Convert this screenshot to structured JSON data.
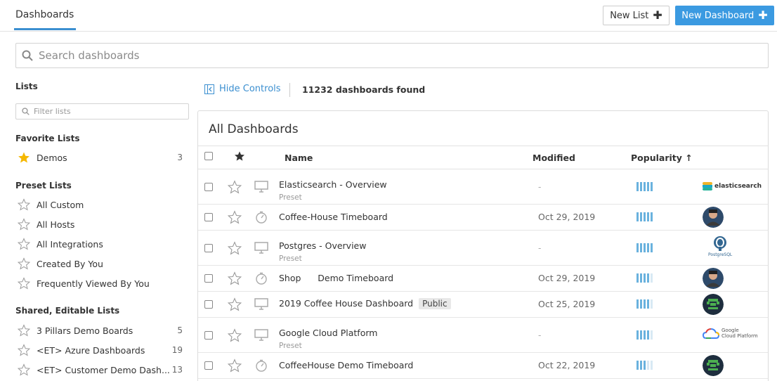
{
  "header": {
    "tab_label": "Dashboards",
    "new_list_label": "New List",
    "new_dashboard_label": "New Dashboard"
  },
  "search": {
    "placeholder": "Search dashboards"
  },
  "sidebar": {
    "lists_heading": "Lists",
    "filter_placeholder": "Filter lists",
    "favorite_heading": "Favorite Lists",
    "favorites": [
      {
        "label": "Demos",
        "count": "3"
      }
    ],
    "preset_heading": "Preset Lists",
    "presets": [
      {
        "label": "All Custom"
      },
      {
        "label": "All Hosts"
      },
      {
        "label": "All Integrations"
      },
      {
        "label": "Created By You"
      },
      {
        "label": "Frequently Viewed By You"
      }
    ],
    "shared_heading": "Shared, Editable Lists",
    "shared": [
      {
        "label": "3 Pillars Demo Boards",
        "count": "5"
      },
      {
        "label": "<ET> Azure Dashboards",
        "count": "19"
      },
      {
        "label": "<ET> Customer Demo Dash...",
        "count": "13"
      }
    ]
  },
  "controls": {
    "hide_controls_label": "Hide Controls",
    "found_text": "11232 dashboards found"
  },
  "table": {
    "title": "All Dashboards",
    "col_name": "Name",
    "col_modified": "Modified",
    "col_popularity": "Popularity",
    "sort_arrow": "↑",
    "rows": [
      {
        "name": "Elasticsearch - Overview",
        "sub": "Preset",
        "modified": "-",
        "popularity": 5,
        "type": "screenboard",
        "owner": "elasticsearch"
      },
      {
        "name": "Coffee-House Timeboard",
        "sub": "",
        "modified": "Oct 29, 2019",
        "popularity": 5,
        "type": "timeboard",
        "owner": "avatar-person"
      },
      {
        "name": "Postgres - Overview",
        "sub": "Preset",
        "modified": "-",
        "popularity": 5,
        "type": "screenboard",
        "owner": "PostgreSQL"
      },
      {
        "name": "Shop      Demo Timeboard",
        "sub": "",
        "modified": "Oct 29, 2019",
        "popularity": 4,
        "type": "timeboard",
        "owner": "avatar-person"
      },
      {
        "name": "2019 Coffee House Dashboard",
        "badge": "Public",
        "sub": "",
        "modified": "Oct 25, 2019",
        "popularity": 4,
        "type": "screenboard",
        "owner": "avatar-robot"
      },
      {
        "name": "Google Cloud Platform",
        "sub": "Preset",
        "modified": "-",
        "popularity": 4,
        "type": "screenboard",
        "owner": "Google Cloud Platform"
      },
      {
        "name": "CoffeeHouse Demo Timeboard",
        "sub": "",
        "modified": "Oct 22, 2019",
        "popularity": 3,
        "type": "timeboard",
        "owner": "avatar-robot"
      }
    ]
  },
  "logos": {
    "elasticsearch": "elasticsearch",
    "postgres": "PostgreSQL",
    "google_line1": "Google",
    "google_line2": "Cloud Platform"
  },
  "colors": {
    "accent": "#3b9ae1",
    "popularity_on": "#6ab2de",
    "popularity_off": "#d8e9f4",
    "star_favorite": "#f5b800"
  }
}
